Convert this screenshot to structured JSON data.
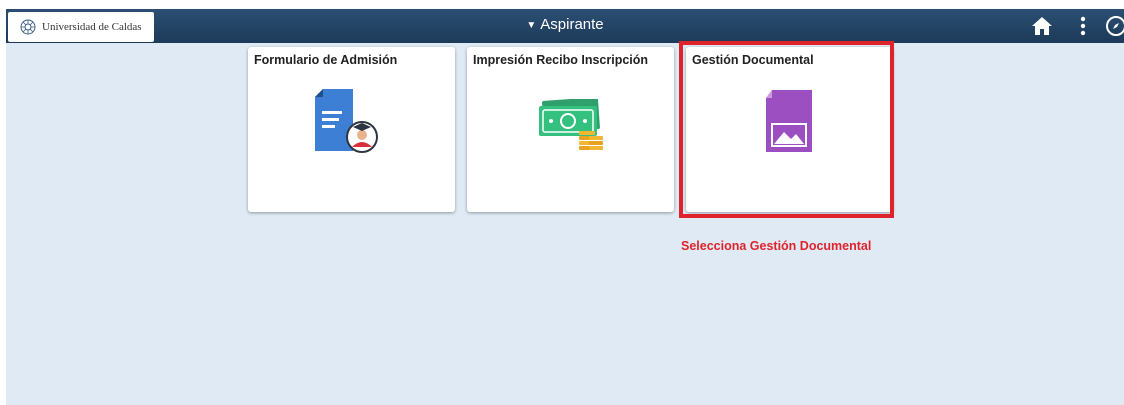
{
  "header": {
    "logo_text": "Universidad de Caldas",
    "title": "Aspirante",
    "title_caret": "▼",
    "icons": [
      "home-icon",
      "kebab-menu-icon",
      "navbar-compass-icon"
    ]
  },
  "tiles": [
    {
      "label": "Formulario de Admisión",
      "icon": "admission-form-icon"
    },
    {
      "label": "Impresión Recibo Inscripción",
      "icon": "receipt-money-icon"
    },
    {
      "label": "Gestión Documental",
      "icon": "document-image-icon"
    }
  ],
  "annotation": {
    "text": "Selecciona Gestión Documental",
    "color": "#e0232b"
  },
  "colors": {
    "header_bg": "#1d3a59",
    "page_bg": "#dfeaf5"
  }
}
